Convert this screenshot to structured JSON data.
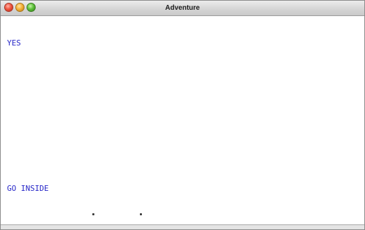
{
  "window": {
    "title": "Adventure",
    "controls": [
      {
        "name": "close-button",
        "icon": "close-icon",
        "color": "#f0553f"
      },
      {
        "name": "minimize-button",
        "icon": "minimize-icon",
        "color": "#f5b23a"
      },
      {
        "name": "zoom-button",
        "icon": "zoom-icon",
        "color": "#5ec23b"
      }
    ]
  },
  "transcript": {
    "lines": [
      "YES",
      "GO INSIDE"
    ],
    "text_color": "#2626c8"
  }
}
